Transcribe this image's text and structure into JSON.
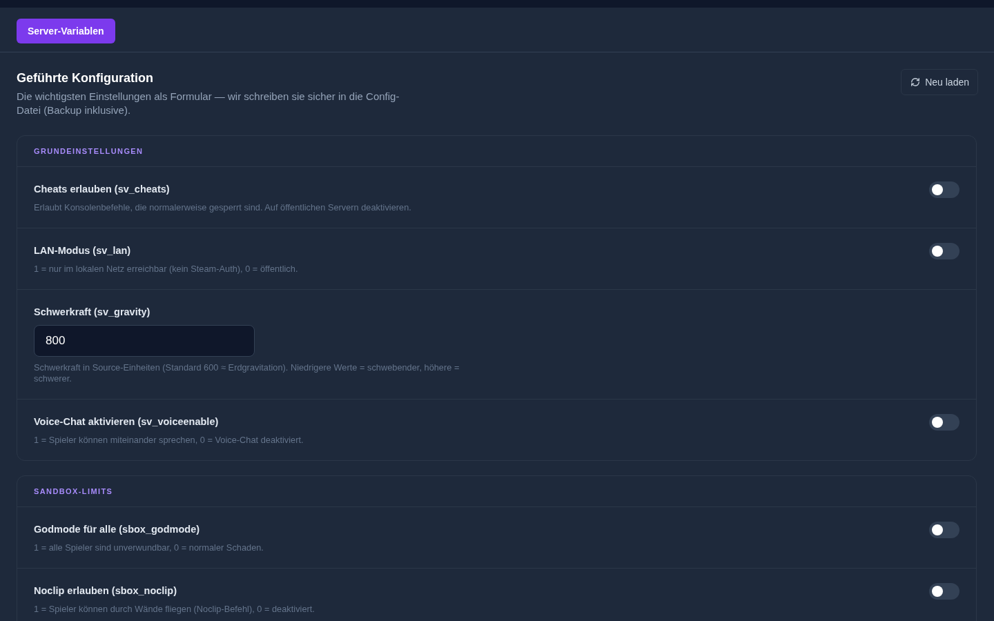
{
  "toolbar": {
    "tabs": [
      {
        "label": "Server-Variablen",
        "selected": true
      }
    ]
  },
  "header": {
    "title": "Geführte Konfiguration",
    "description": "Die wichtigsten Einstellungen als Formular — wir schreiben sie sicher in die Config-Datei (Backup inklusive).",
    "reload_button": "Neu laden"
  },
  "sections": [
    {
      "title": "GRUNDEINSTELLUNGEN",
      "settings": [
        {
          "kind": "toggle",
          "label": "Cheats erlauben (sv_cheats)",
          "description": "Erlaubt Konsolenbefehle, die normalerweise gesperrt sind. Auf öffentlichen Servern deaktivieren.",
          "on": false
        },
        {
          "kind": "toggle",
          "label": "LAN-Modus (sv_lan)",
          "description": "1 = nur im lokalen Netz erreichbar (kein Steam-Auth), 0 = öffentlich.",
          "on": false
        },
        {
          "kind": "number",
          "label": "Schwerkraft (sv_gravity)",
          "value": "800",
          "description": "Schwerkraft in Source-Einheiten (Standard 600 ≈ Erdgravitation). Niedrigere Werte = schwebender, höhere = schwerer."
        },
        {
          "kind": "toggle",
          "label": "Voice-Chat aktivieren (sv_voiceenable)",
          "description": "1 = Spieler können miteinander sprechen, 0 = Voice-Chat deaktiviert.",
          "on": false
        }
      ]
    },
    {
      "title": "SANDBOX-LIMITS",
      "settings": [
        {
          "kind": "toggle",
          "label": "Godmode für alle (sbox_godmode)",
          "description": "1 = alle Spieler sind unverwundbar, 0 = normaler Schaden.",
          "on": false
        },
        {
          "kind": "toggle",
          "label": "Noclip erlauben (sbox_noclip)",
          "description": "1 = Spieler können durch Wände fliegen (Noclip-Befehl), 0 = deaktiviert.",
          "on": false
        }
      ]
    }
  ]
}
